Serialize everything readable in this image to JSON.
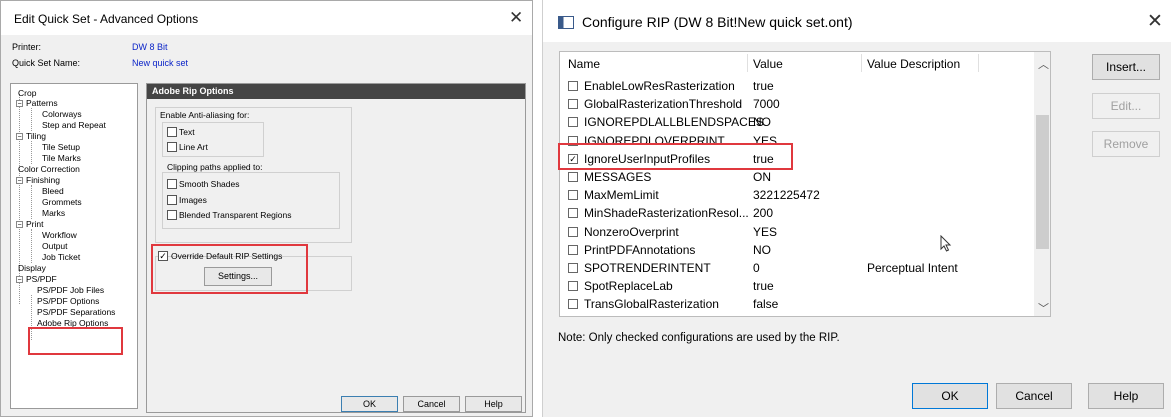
{
  "left_dialog": {
    "title": "Edit Quick Set - Advanced Options",
    "printer_label": "Printer:",
    "printer_value": "DW 8 Bit",
    "quickset_label": "Quick Set Name:",
    "quickset_value": "New quick set",
    "tree": [
      {
        "label": "Crop"
      },
      {
        "label": "Patterns",
        "toggle": "−"
      },
      {
        "label": "Colorways"
      },
      {
        "label": "Step and Repeat"
      },
      {
        "label": "Tiling",
        "toggle": "−"
      },
      {
        "label": "Tile Setup"
      },
      {
        "label": "Tile Marks"
      },
      {
        "label": "Color Correction"
      },
      {
        "label": "Finishing",
        "toggle": "−"
      },
      {
        "label": "Bleed"
      },
      {
        "label": "Grommets"
      },
      {
        "label": "Marks"
      },
      {
        "label": "Print",
        "toggle": "−"
      },
      {
        "label": "Workflow"
      },
      {
        "label": "Output"
      },
      {
        "label": "Job Ticket"
      },
      {
        "label": "Display"
      },
      {
        "label": "PS/PDF",
        "toggle": "−"
      },
      {
        "label": "PS/PDF Job Files"
      },
      {
        "label": "PS/PDF Options"
      },
      {
        "label": "PS/PDF Separations"
      },
      {
        "label": "Adobe Rip Options"
      }
    ],
    "panel_title": "Adobe Rip Options",
    "antialias_label": "Enable Anti-aliasing for:",
    "antialias_text": "Text",
    "antialias_lineart": "Line Art",
    "clipping_label": "Clipping paths applied to:",
    "clip_smooth": "Smooth Shades",
    "clip_images": "Images",
    "clip_blended": "Blended Transparent Regions",
    "override_label": "Override Default RIP Settings",
    "settings_button": "Settings...",
    "ok": "OK",
    "cancel": "Cancel",
    "help": "Help"
  },
  "right_dialog": {
    "title": "Configure RIP (DW 8 Bit!New quick set.ont)",
    "columns": [
      "Name",
      "Value",
      "Value Description"
    ],
    "rows": [
      {
        "name": "EnableLowResRasterization",
        "value": "true",
        "desc": "",
        "checked": false
      },
      {
        "name": "GlobalRasterizationThreshold",
        "value": "7000",
        "desc": "",
        "checked": false
      },
      {
        "name": "IGNOREPDLALLBLENDSPACES",
        "value": "NO",
        "desc": "",
        "checked": false
      },
      {
        "name": "IGNOREPDLOVERPRINT",
        "value": "YES",
        "desc": "",
        "checked": false
      },
      {
        "name": "IgnoreUserInputProfiles",
        "value": "true",
        "desc": "",
        "checked": true
      },
      {
        "name": "MESSAGES",
        "value": "ON",
        "desc": "",
        "checked": false
      },
      {
        "name": "MaxMemLimit",
        "value": "3221225472",
        "desc": "",
        "checked": false
      },
      {
        "name": "MinShadeRasterizationResol...",
        "value": "200",
        "desc": "",
        "checked": false
      },
      {
        "name": "NonzeroOverprint",
        "value": "YES",
        "desc": "",
        "checked": false
      },
      {
        "name": "PrintPDFAnnotations",
        "value": "NO",
        "desc": "",
        "checked": false
      },
      {
        "name": "SPOTRENDERINTENT",
        "value": "0",
        "desc": "Perceptual Intent",
        "checked": false
      },
      {
        "name": "SpotReplaceLab",
        "value": "true",
        "desc": "",
        "checked": false
      },
      {
        "name": "TransGlobalRasterization",
        "value": "false",
        "desc": "",
        "checked": false
      }
    ],
    "insert": "Insert...",
    "edit": "Edit...",
    "remove": "Remove",
    "note": "Note: Only checked configurations are used by the RIP.",
    "ok": "OK",
    "cancel": "Cancel",
    "help": "Help"
  }
}
